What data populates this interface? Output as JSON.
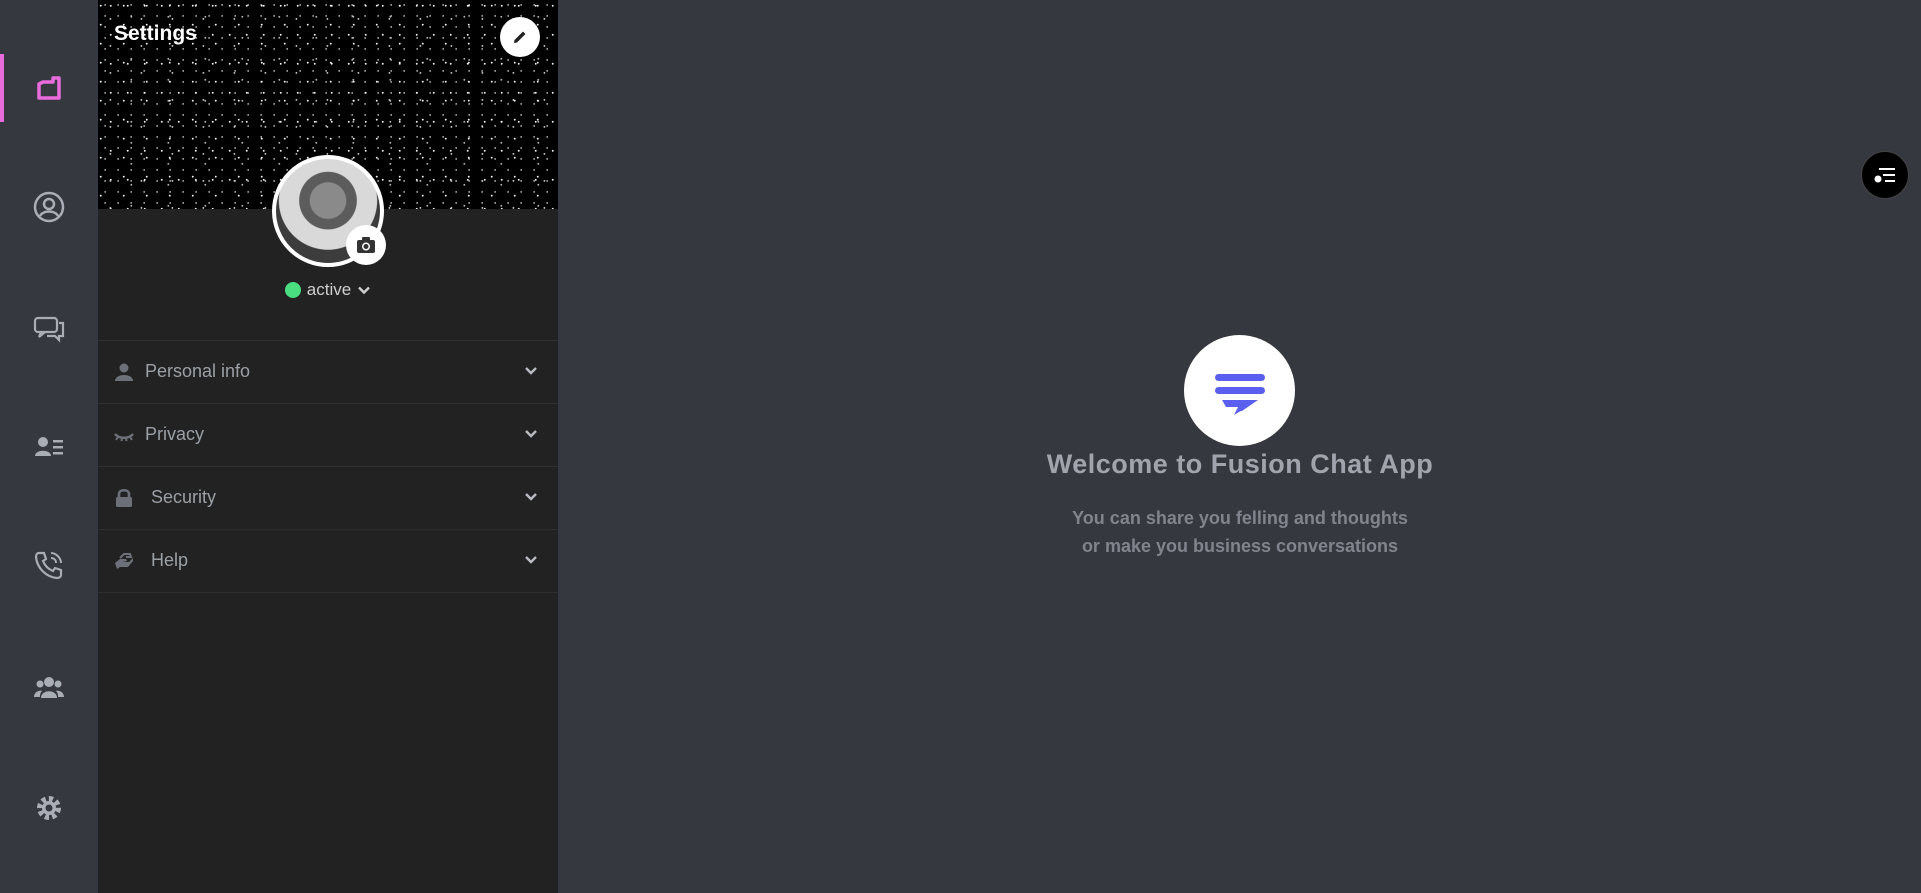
{
  "colors": {
    "accent": "#e96bdc",
    "status_online": "#4ade80",
    "brand_blue": "#5a5ff0",
    "panel_bg": "#222222",
    "main_bg": "#363840"
  },
  "rail": {
    "items": [
      {
        "icon": "app-logo-icon",
        "active": true
      },
      {
        "icon": "user-circle-icon"
      },
      {
        "icon": "chat-bubbles-icon"
      },
      {
        "icon": "contacts-icon"
      },
      {
        "icon": "phone-wifi-icon"
      },
      {
        "icon": "groups-icon"
      },
      {
        "icon": "gear-icon"
      }
    ]
  },
  "settings": {
    "title": "Settings",
    "status": {
      "label": "active"
    },
    "sections": [
      {
        "label": "Personal info",
        "icon": "user-icon"
      },
      {
        "label": "Privacy",
        "icon": "eye-closed-icon"
      },
      {
        "label": "Security",
        "icon": "lock-icon"
      },
      {
        "label": "Help",
        "icon": "help-hands-icon"
      }
    ]
  },
  "main": {
    "welcome_title": "Welcome to Fusion Chat App",
    "welcome_line1": "You can share you felling and thoughts",
    "welcome_line2": "or make you business conversations"
  }
}
